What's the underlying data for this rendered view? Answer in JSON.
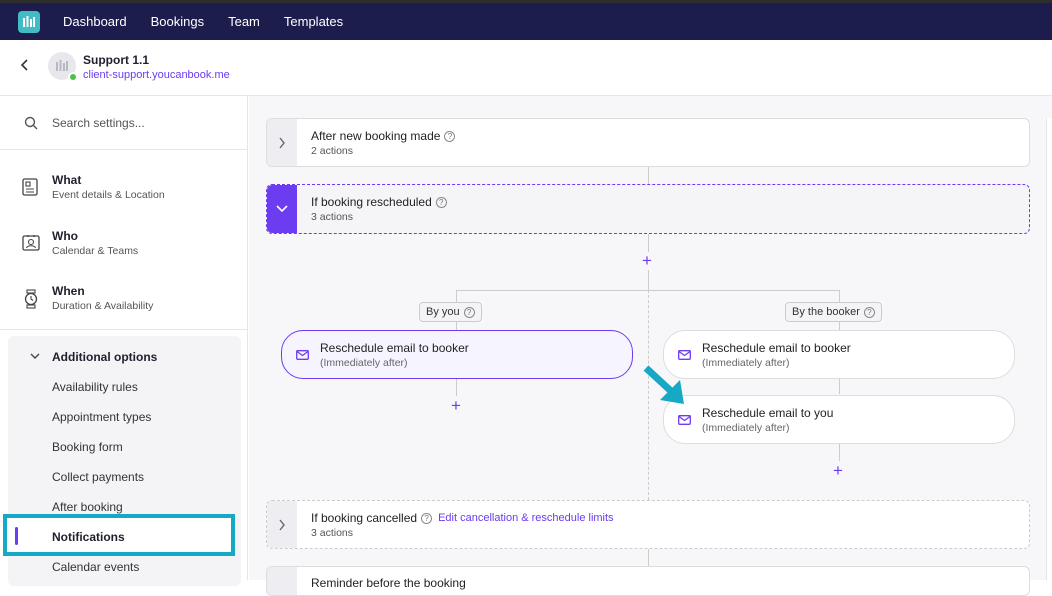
{
  "topnav": {
    "items": [
      "Dashboard",
      "Bookings",
      "Team",
      "Templates"
    ]
  },
  "account": {
    "name": "Support 1.1",
    "url": "client-support.youcanbook.me"
  },
  "search": {
    "placeholder": "Search settings..."
  },
  "sections": [
    {
      "title": "What",
      "subtitle": "Event details & Location",
      "icon": "document-icon"
    },
    {
      "title": "Who",
      "subtitle": "Calendar & Teams",
      "icon": "contact-card-icon"
    },
    {
      "title": "When",
      "subtitle": "Duration & Availability",
      "icon": "watch-icon"
    }
  ],
  "additional": {
    "title": "Additional options",
    "items": [
      "Availability rules",
      "Appointment types",
      "Booking form",
      "Collect payments",
      "After booking",
      "Notifications",
      "Calendar events"
    ],
    "active": "Notifications"
  },
  "workflows": {
    "new_booking": {
      "title": "After new booking made",
      "count": "2 actions"
    },
    "rescheduled": {
      "title": "If booking rescheduled",
      "count": "3 actions"
    },
    "cancelled": {
      "title": "If booking cancelled",
      "count": "3 actions",
      "link": "Edit cancellation & reschedule limits"
    },
    "partial_title": "Reminder before the booking"
  },
  "branches": {
    "by_you": {
      "label": "By you",
      "actions": [
        {
          "title": "Reschedule email to booker",
          "timing": "(Immediately after)"
        }
      ]
    },
    "by_booker": {
      "label": "By the booker",
      "actions": [
        {
          "title": "Reschedule email to booker",
          "timing": "(Immediately after)"
        },
        {
          "title": "Reschedule email to you",
          "timing": "(Immediately after)"
        }
      ]
    }
  },
  "colors": {
    "accent": "#6b3cf0",
    "highlight": "#16a8c4",
    "nav_bg": "#1d1d4d"
  }
}
